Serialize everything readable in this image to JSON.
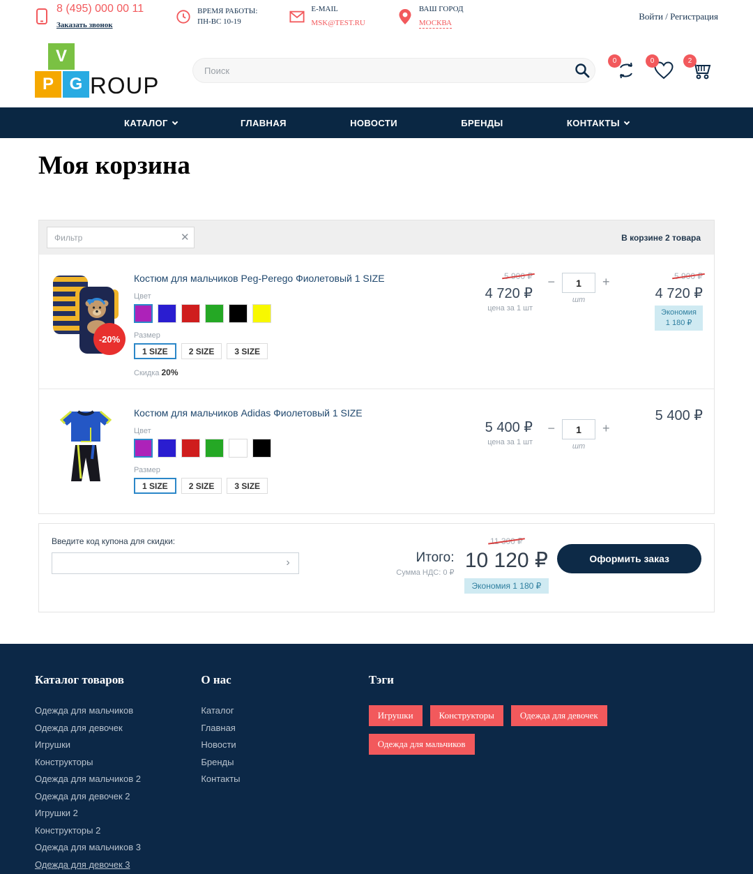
{
  "topbar": {
    "phone": "8 (495) 000 00 11",
    "callback": "Заказать звонок",
    "worktime_label": "ВРЕМЯ РАБОТЫ:",
    "worktime_value": "ПН-ВС 10-19",
    "email_label": "E-MAIL",
    "email_value": "MSK@TEST.RU",
    "city_label": "ВАШ ГОРОД",
    "city_value": "МОСКВА",
    "auth": "Войти / Регистрация"
  },
  "header": {
    "logo_v": "V",
    "logo_p": "P",
    "logo_g": "G",
    "logo_rest": "ROUP",
    "search_placeholder": "Поиск",
    "compare_count": "0",
    "wishlist_count": "0",
    "cart_count": "2"
  },
  "nav": {
    "items": [
      "КАТАЛОГ",
      "ГЛАВНАЯ",
      "НОВОСТИ",
      "БРЕНДЫ",
      "КОНТАКТЫ"
    ]
  },
  "page": {
    "title": "Моя корзина"
  },
  "cart": {
    "filter_placeholder": "Фильтр",
    "filter_clear": "✕",
    "count_text": "В корзине 2 товара",
    "color_label": "Цвет",
    "size_label": "Размер",
    "discount_label": "Скидка",
    "per_unit_label": "цена за 1 шт",
    "qty_unit_label": "шт",
    "qty_minus": "−",
    "qty_plus": "+",
    "items": [
      {
        "name": "Костюм для мальчиков Peg-Perego Фиолетовый 1 SIZE",
        "discount_badge": "-20%",
        "discount_value": "20%",
        "colors": [
          "#ad22b9",
          "#2a1dd0",
          "#cf1d1d",
          "#25a825",
          "#000000",
          "#f8f800"
        ],
        "sizes": [
          "1 SIZE",
          "2 SIZE",
          "3 SIZE"
        ],
        "old_price": "5 900 ₽",
        "price": "4 720 ₽",
        "qty": "1",
        "total_old": "5 900 ₽",
        "total": "4 720 ₽",
        "saving_line1": "Экономия",
        "saving_line2": "1 180 ₽"
      },
      {
        "name": "Костюм для мальчиков Adidas Фиолетовый 1 SIZE",
        "colors": [
          "#ad22b9",
          "#2a1dd0",
          "#cf1d1d",
          "#25a825",
          "#ffffff",
          "#000000"
        ],
        "sizes": [
          "1 SIZE",
          "2 SIZE",
          "3 SIZE"
        ],
        "price": "5 400 ₽",
        "qty": "1",
        "total": "5 400 ₽"
      }
    ]
  },
  "summary": {
    "coupon_label": "Введите код купона для скидки:",
    "coupon_arrow": "›",
    "total_label": "Итого:",
    "vat_text": "Сумма НДС: 0 ₽",
    "old_total": "11 300 ₽",
    "total": "10 120 ₽",
    "saving_text": "Экономия 1 180 ₽",
    "checkout_label": "Оформить заказ"
  },
  "footer": {
    "catalog_title": "Каталог товаров",
    "catalog_links": [
      "Одежда для мальчиков",
      "Одежда для девочек",
      "Игрушки",
      "Конструкторы",
      "Одежда для мальчиков 2",
      "Одежда для девочек 2",
      "Игрушки 2",
      "Конструкторы 2",
      "Одежда для мальчиков 3",
      "Одежда для девочек 3"
    ],
    "about_title": "О нас",
    "about_links": [
      "Каталог",
      "Главная",
      "Новости",
      "Бренды",
      "Контакты"
    ],
    "tags_title": "Тэги",
    "tags": [
      "Игрушки",
      "Конструкторы",
      "Одежда для девочек",
      "Одежда для мальчиков"
    ]
  },
  "colors": {
    "accent_red": "#f2595c",
    "navy": "#0c2847",
    "select_blue": "#2b87c8",
    "saving_bg": "#cfeaf2",
    "saving_text": "#2f7f9f"
  }
}
